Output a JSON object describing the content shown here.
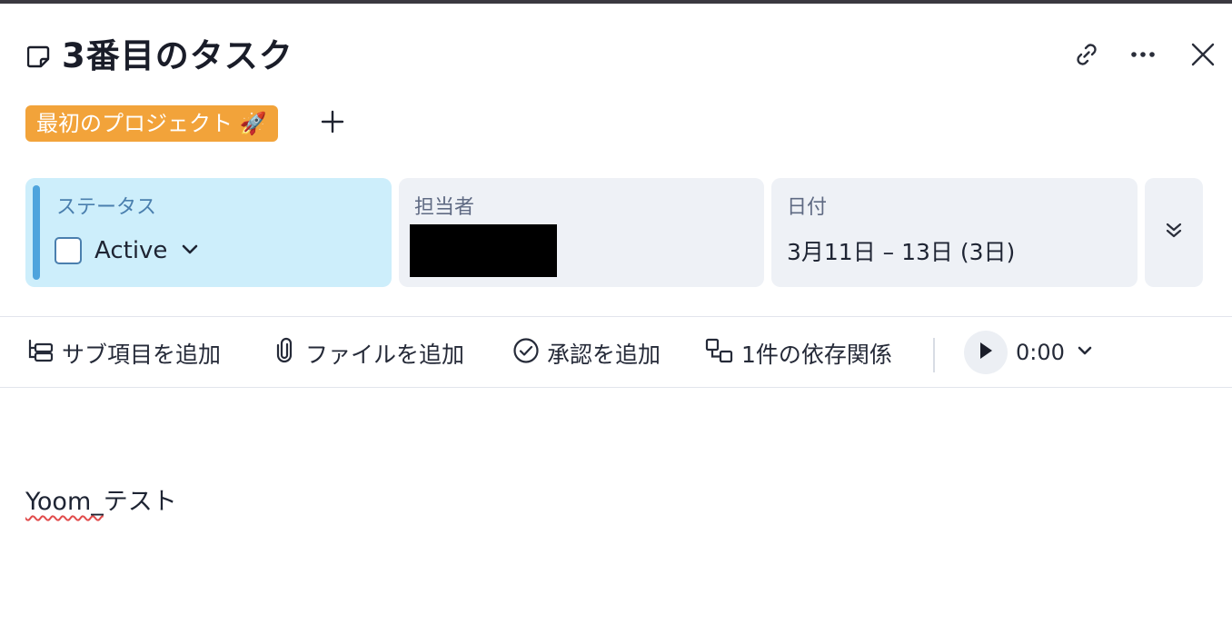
{
  "task": {
    "title": "3番目のタスク"
  },
  "tags": {
    "project_label": "最初のプロジェクト 🚀"
  },
  "fields": {
    "status": {
      "label": "ステータス",
      "value": "Active"
    },
    "assignee": {
      "label": "担当者"
    },
    "date": {
      "label": "日付",
      "value": "3月11日 – 13日 (3日)"
    }
  },
  "toolbar": {
    "add_subtask": "サブ項目を追加",
    "add_file": "ファイルを追加",
    "add_approval": "承認を追加",
    "dependencies": "1件の依存関係",
    "timer": "0:00"
  },
  "description": {
    "prefix": "Yoom_",
    "suffix": "テスト"
  },
  "colors": {
    "tag": "#f2a33a",
    "status_bg": "#cdeefb",
    "status_accent": "#4ea4dd",
    "field_bg": "#eef1f6"
  }
}
